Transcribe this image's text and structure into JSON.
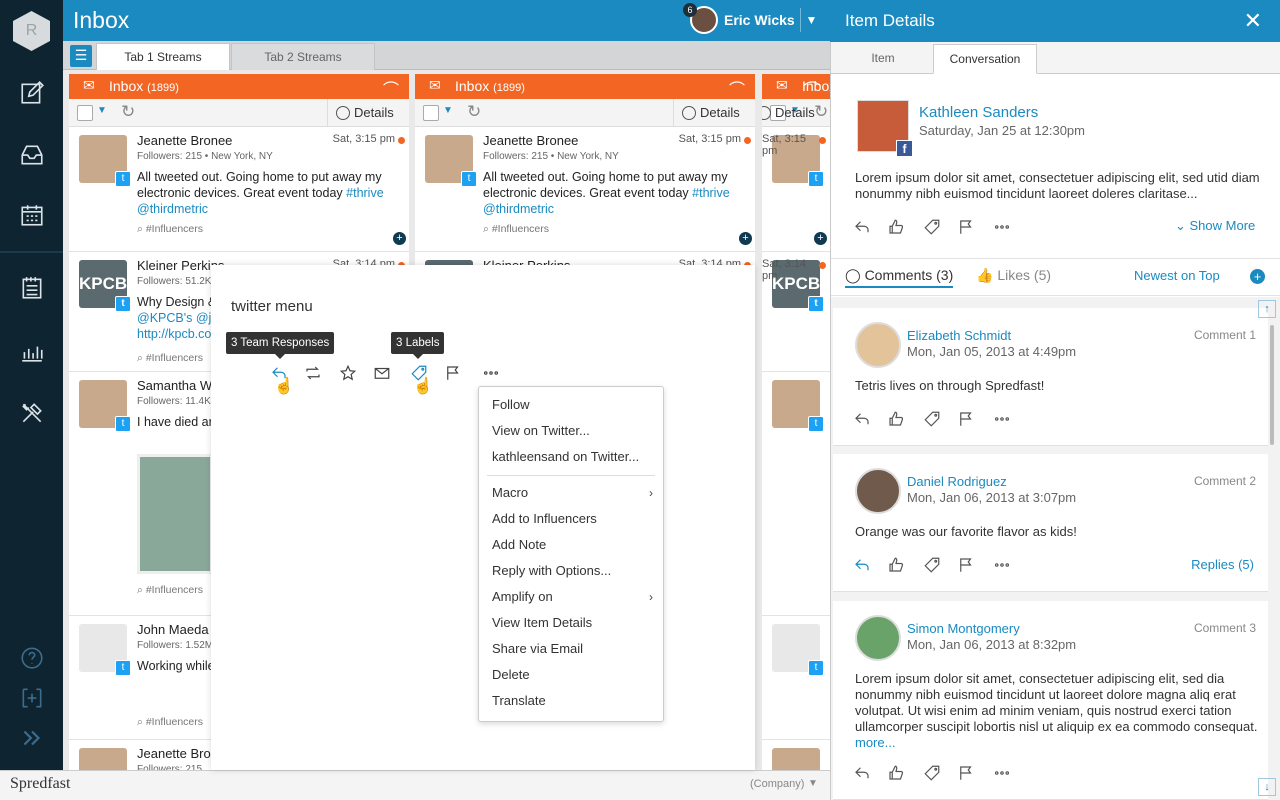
{
  "rail": {
    "logo_letter": "R"
  },
  "topbar": {
    "title": "Inbox",
    "user_name": "Eric Wicks",
    "notification_count": "6"
  },
  "tabs": [
    {
      "label": "Tab 1 Streams"
    },
    {
      "label": "Tab 2 Streams"
    }
  ],
  "stream": {
    "title": "Inbox",
    "count": "(1899)",
    "details_label": "Details"
  },
  "posts": [
    {
      "name": "Jeanette Bronee",
      "date": "Sat, 3:15 pm",
      "followers": "Followers: 215 • New York, NY",
      "text": "All tweeted out. Going home to put away my electronic devices. Great event today ",
      "hashtag": "#thrive",
      "mention": "@thirdmetric",
      "tag": "#Influencers"
    },
    {
      "name": "Kleiner Perkins",
      "date": "Sat, 3:14 pm",
      "followers": "Followers: 51.2K",
      "text": "Why Design &",
      "mention": "@KPCB's @jo",
      "link": "http://kpcb.co",
      "tag": "#Influencers"
    },
    {
      "name": "Samantha Wa",
      "followers": "Followers: 11.4K",
      "text": "I have died ar heaven!",
      "tag": "#Influencers"
    },
    {
      "name": "John Maeda",
      "followers": "Followers: 1.52M",
      "text": "Working while maybe you're really close.",
      "tag": "#Influencers"
    },
    {
      "name": "Jeanette Bron",
      "followers": "Followers: 215"
    }
  ],
  "kpcb_logo": "KPCB",
  "twitter_menu": {
    "title": "twitter menu",
    "tooltip_responses": "3 Team Responses",
    "tooltip_labels": "3 Labels",
    "items": [
      "Follow",
      "View on Twitter...",
      "kathleensand on Twitter...",
      "Macro",
      "Add to Influencers",
      "Add Note",
      "Reply with Options...",
      "Amplify on",
      "View Item Details",
      "Share via Email",
      "Delete",
      "Translate"
    ]
  },
  "bottom": {
    "brand": "Spredfast",
    "company": "(Company)"
  },
  "details": {
    "title": "Item Details",
    "tabs": [
      "Item",
      "Conversation"
    ],
    "author": "Kathleen Sanders",
    "date": "Saturday, Jan 25 at 12:30pm",
    "text": "Lorem ipsum dolor sit amet, consectetuer adipiscing elit, sed utid diam nonummy nibh euismod tincidunt laoreet doleres claritase...",
    "show_more": "Show More",
    "comments_tab": "Comments (3)",
    "likes_tab": "Likes (5)",
    "sort": "Newest on Top",
    "comments": [
      {
        "name": "Elizabeth Schmidt",
        "date": "Mon, Jan 05, 2013 at 4:49pm",
        "num": "Comment 1",
        "text": "Tetris lives on through Spredfast!"
      },
      {
        "name": "Daniel Rodriguez",
        "date": "Mon, Jan 06, 2013 at 3:07pm",
        "num": "Comment 2",
        "text": "Orange was our favorite flavor as kids!",
        "replies": "Replies (5)"
      },
      {
        "name": "Simon Montgomery",
        "date": "Mon, Jan 06, 2013 at 8:32pm",
        "num": "Comment 3",
        "text": "Lorem ipsum dolor sit amet, consectetuer adipiscing elit, sed dia nonummy nibh euismod tincidunt ut laoreet dolore magna aliq erat volutpat. Ut wisi enim ad minim veniam, quis nostrud exerci tation ullamcorper suscipit lobortis nisl ut aliquip ex ea commodo consequat.",
        "more": "more..."
      }
    ]
  },
  "colors": {
    "primary": "#1a8ac0",
    "stream_header": "#f26523",
    "rail": "#0f2431"
  }
}
